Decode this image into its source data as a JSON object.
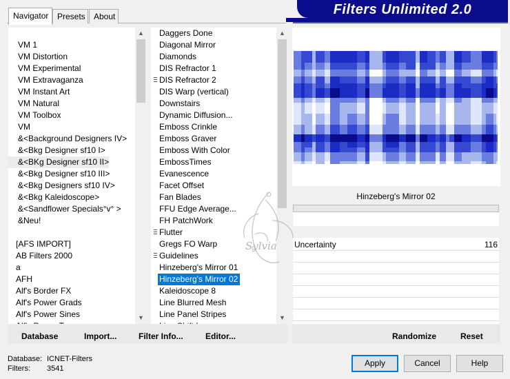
{
  "tabs": [
    {
      "label": "Navigator",
      "active": true
    },
    {
      "label": "Presets",
      "active": false
    },
    {
      "label": "About",
      "active": false
    }
  ],
  "title": "Filters Unlimited 2.0",
  "categories": [
    "VM 1",
    "VM Distortion",
    "VM Experimental",
    "VM Extravaganza",
    "VM Instant Art",
    "VM Natural",
    "VM Toolbox",
    "VM",
    "&<Background Designers IV>",
    "&<Bkg Designer sf10 I>",
    "&<BKg Designer sf10 II>",
    "&<Bkg Designer sf10 III>",
    "&<Bkg Designers sf10 IV>",
    "&<Bkg Kaleidoscope>",
    "&<Sandflower Specials°v° >",
    "&Neu!",
    "",
    "[AFS IMPORT]",
    "AB Filters 2000",
    "a",
    "AFH",
    "Alf's Border FX",
    "Alf's Power Grads",
    "Alf's Power Sines",
    "Alf's Power Toys"
  ],
  "categories_selected_index": 10,
  "filters": [
    "Daggers Done",
    "Diagonal Mirror",
    "Diamonds",
    "DIS Refractor 1",
    "DIS Refractor 2",
    "DIS Warp (vertical)",
    "Downstairs",
    "Dynamic Diffusion...",
    "Emboss Crinkle",
    "Emboss Graver",
    "Emboss With Color",
    "EmbossTimes",
    "Evanescence",
    "Facet Offset",
    "Fan Blades",
    "FFU Edge Average...",
    "FH PatchWork",
    "Flutter",
    "Gregs FO Warp",
    "Guidelines",
    "Hinzeberg's Mirror 01",
    "Hinzeberg's Mirror 02",
    "Kaleidoscope 8",
    "Line Blurred Mesh",
    "Line Panel Stripes",
    "Line Shift Lr"
  ],
  "filters_with_grip": [
    4,
    17,
    19
  ],
  "filters_selected_index": 21,
  "selected_filter_name": "Hinzeberg's Mirror 02",
  "parameter": {
    "label": "Uncertainty",
    "value": "116"
  },
  "actions": {
    "database": "Database",
    "import": "Import...",
    "filter_info": "Filter Info...",
    "editor": "Editor...",
    "randomize": "Randomize",
    "reset": "Reset"
  },
  "buttons": {
    "apply": "Apply",
    "cancel": "Cancel",
    "help": "Help"
  },
  "status": {
    "database_label": "Database:",
    "database_value": "ICNET-Filters",
    "filters_label": "Filters:",
    "filters_value": "3541"
  },
  "watermark_text": "Sylvia",
  "colors": {
    "banner": "#0b0c8c",
    "selection": "#0078d7",
    "preview_dark": "#0b0c8c"
  }
}
